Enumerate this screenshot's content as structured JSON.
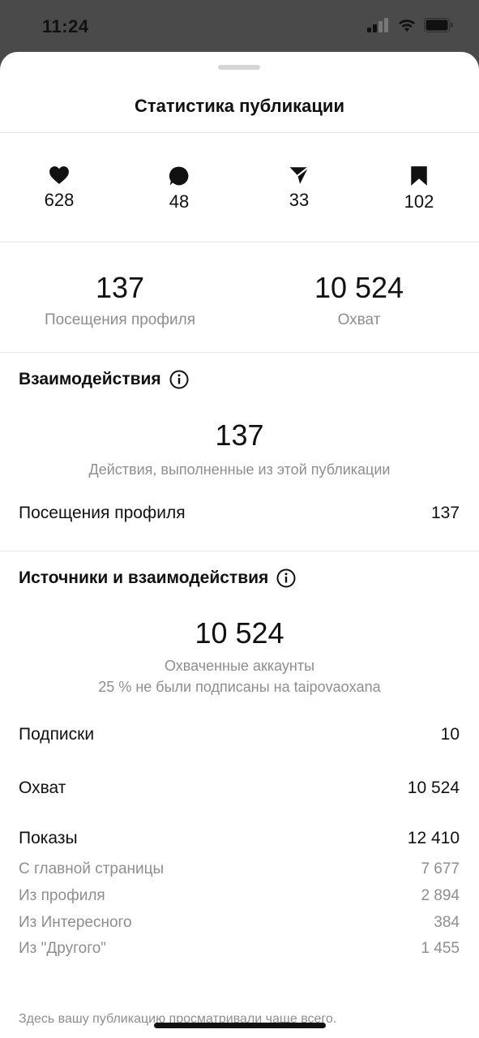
{
  "status": {
    "time": "11:24"
  },
  "sheet": {
    "title": "Статистика публикации"
  },
  "icons": [
    {
      "icon": "heart-icon",
      "value": "628"
    },
    {
      "icon": "comment-icon",
      "value": "48"
    },
    {
      "icon": "share-icon",
      "value": "33"
    },
    {
      "icon": "bookmark-icon",
      "value": "102"
    }
  ],
  "top_stats": {
    "profile_visits": {
      "value": "137",
      "label": "Посещения профиля"
    },
    "reach": {
      "value": "10 524",
      "label": "Охват"
    }
  },
  "interactions": {
    "title": "Взаимодействия",
    "value": "137",
    "subtitle": "Действия, выполненные из этой публикации",
    "rows": [
      {
        "label": "Посещения профиля",
        "value": "137"
      }
    ]
  },
  "discovery": {
    "title": "Источники и взаимодействия",
    "value": "10 524",
    "subtitle1": "Охваченные аккаунты",
    "subtitle2": "25 % не были подписаны на taipovaoxana",
    "follows": {
      "label": "Подписки",
      "value": "10"
    },
    "reach": {
      "label": "Охват",
      "value": "10 524"
    },
    "impressions": {
      "label": "Показы",
      "value": "12 410"
    },
    "impression_sources": [
      {
        "label": "С главной страницы",
        "value": "7 677"
      },
      {
        "label": "Из профиля",
        "value": "2 894"
      },
      {
        "label": "Из Интересного",
        "value": "384"
      },
      {
        "label": "Из \"Другого\"",
        "value": "1 455"
      }
    ]
  },
  "footer": {
    "text": "Здесь вашу публикацию просматривали чаще всего."
  },
  "colors": {
    "text": "#111111",
    "secondary": "#8e8e8e",
    "divider": "#e6e6e6",
    "statusbar": "#4a4a4a"
  }
}
